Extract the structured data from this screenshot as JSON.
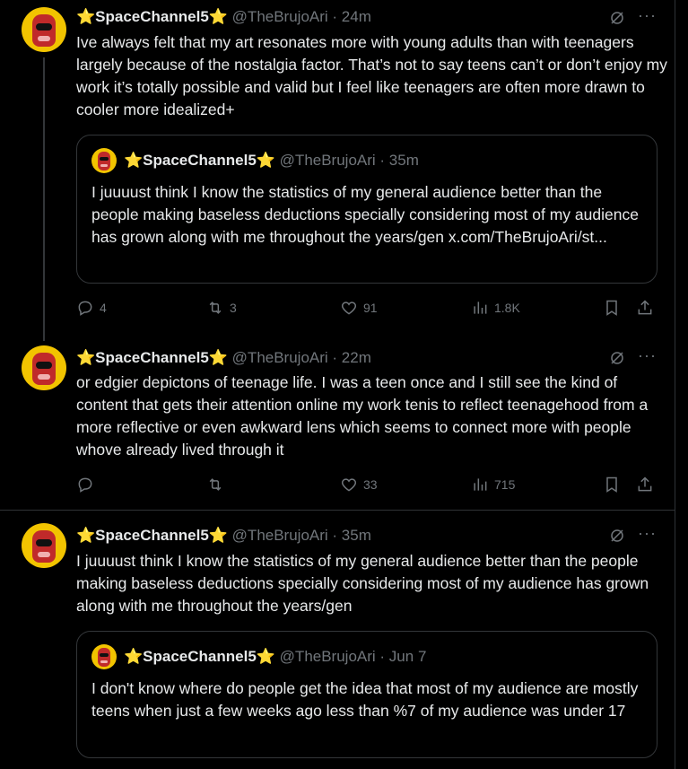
{
  "tweets": [
    {
      "name": "⭐SpaceChannel5⭐",
      "handle": "@TheBrujoAri",
      "time": "· 24m",
      "text": "Ive always felt that my art resonates more with young adults than with teenagers largely because of the nostalgia factor. That’s not to say teens can’t or don’t enjoy my work it’s totally possible and valid but I feel like teenagers are often more drawn to cooler more idealized+",
      "quote": {
        "name": "⭐SpaceChannel5⭐",
        "handle": "@TheBrujoAri",
        "time": "· 35m",
        "text": "I juuuust think I know the statistics of my general audience better than the people making baseless deductions specially considering most of my audience has grown along with me throughout the years/gen x.com/TheBrujoAri/st..."
      },
      "replies": "4",
      "reposts": "3",
      "likes": "91",
      "views": "1.8K"
    },
    {
      "name": "⭐SpaceChannel5⭐",
      "handle": "@TheBrujoAri",
      "time": "· 22m",
      "text": "or edgier depictons of teenage life. I was a teen once and I still see the kind of content that gets their attention online my work tenis to reflect teenagehood from a more reflective or even awkward lens which seems to connect more with people whove already lived through it",
      "replies": "",
      "reposts": "",
      "likes": "33",
      "views": "715"
    },
    {
      "name": "⭐SpaceChannel5⭐",
      "handle": "@TheBrujoAri",
      "time": "· 35m",
      "text": "I juuuust think I know the statistics of my general audience better than the people making baseless deductions specially considering most of my audience has grown along with me throughout the years/gen",
      "quote": {
        "name": "⭐SpaceChannel5⭐",
        "handle": "@TheBrujoAri",
        "time": "· Jun 7",
        "text": "I don't know where do people get the idea that most of my audience are mostly teens when just a few weeks ago less than %7 of my audience was under 17"
      }
    }
  ],
  "icons": {
    "more": "···",
    "reply": "reply-icon",
    "repost": "repost-icon",
    "like": "like-icon",
    "views": "views-icon",
    "bookmark": "bookmark-icon",
    "share": "share-icon",
    "grok": "grok-icon"
  },
  "colors": {
    "background": "#000000",
    "text": "#e7e9ea",
    "muted": "#71767b",
    "border": "#333639",
    "avatar": "#f2c400"
  }
}
